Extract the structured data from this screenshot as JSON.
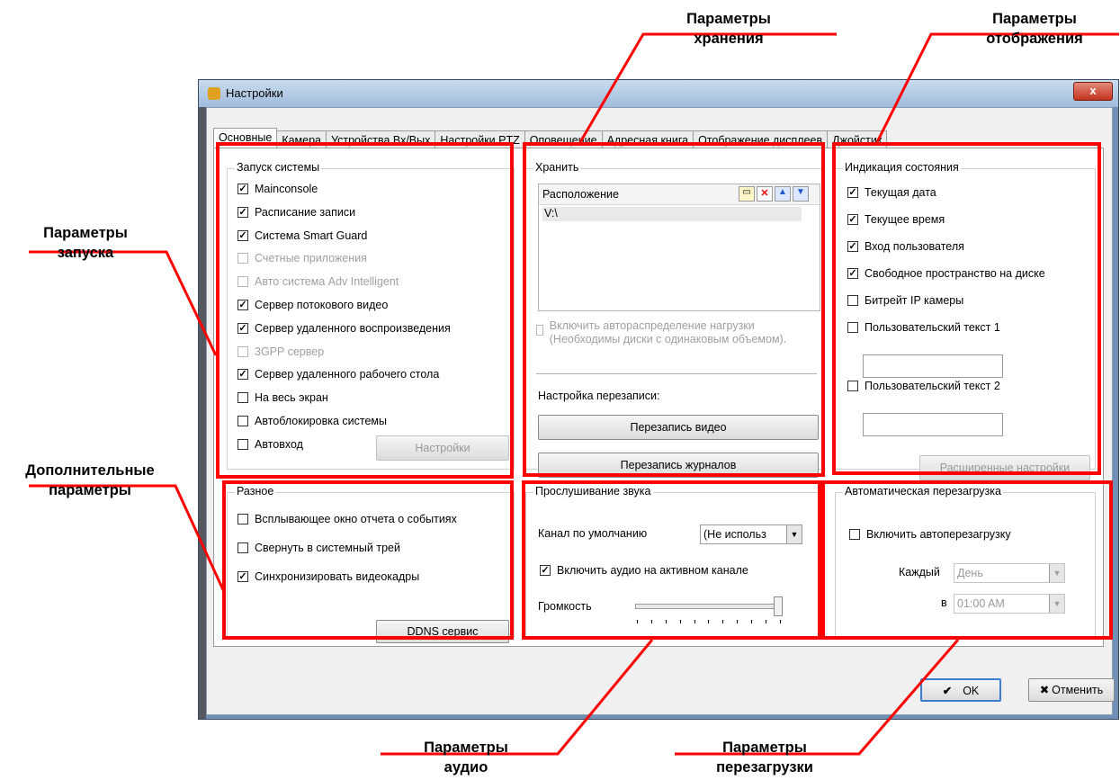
{
  "window": {
    "title": "Настройки",
    "close_glyph": "x"
  },
  "tabs": [
    "Основные",
    "Камера",
    "Устройства Вх/Вых",
    "Настройки PTZ",
    "Оповещение",
    "Адресная книга",
    "Отображение дисплеев",
    "Джойстик"
  ],
  "startup": {
    "title": "Запуск системы",
    "items": [
      {
        "label": "Mainconsole",
        "checked": true,
        "enabled": true
      },
      {
        "label": "Расписание записи",
        "checked": true,
        "enabled": true
      },
      {
        "label": "Система Smart Guard",
        "checked": true,
        "enabled": true
      },
      {
        "label": "Счетные приложения",
        "checked": false,
        "enabled": false
      },
      {
        "label": "Авто система Adv Intelligent",
        "checked": false,
        "enabled": false
      },
      {
        "label": "Сервер потокового видео",
        "checked": true,
        "enabled": true
      },
      {
        "label": "Сервер удаленного воспроизведения",
        "checked": true,
        "enabled": true
      },
      {
        "label": "3GPP сервер",
        "checked": false,
        "enabled": false
      },
      {
        "label": "Сервер удаленного рабочего стола",
        "checked": true,
        "enabled": true
      },
      {
        "label": "На весь экран",
        "checked": false,
        "enabled": true
      },
      {
        "label": "Автоблокировка системы",
        "checked": false,
        "enabled": true
      },
      {
        "label": "Автовход",
        "checked": false,
        "enabled": true
      }
    ],
    "settings_button": "Настройки"
  },
  "storage": {
    "title": "Хранить",
    "column": "Расположение",
    "paths": [
      "V:\\"
    ],
    "balance_label": "Включить автораспределение нагрузки (Необходимы диски с одинаковым объемом).",
    "overwrite_label": "Настройка перезаписи:",
    "video_button": "Перезапись видео",
    "logs_button": "Перезапись журналов"
  },
  "display": {
    "title": "Индикация состояния",
    "items": [
      {
        "label": "Текущая  дата",
        "checked": true
      },
      {
        "label": "Текущее время",
        "checked": true
      },
      {
        "label": "Вход пользователя",
        "checked": true
      },
      {
        "label": "Свободное пространство на диске",
        "checked": true
      },
      {
        "label": "Битрейт IP камеры",
        "checked": false
      },
      {
        "label": "Пользовательский текст 1",
        "checked": false
      },
      {
        "label": "Пользовательский текст 2",
        "checked": false
      }
    ],
    "advanced_button": "Расширенные настройки"
  },
  "misc": {
    "title": "Разное",
    "items": [
      {
        "label": "Всплывающее окно отчета о событиях",
        "checked": false
      },
      {
        "label": "Свернуть в системный трей",
        "checked": false
      },
      {
        "label": "Синхронизировать видеокадры",
        "checked": true
      }
    ],
    "ddns_button": "DDNS сервис"
  },
  "audio": {
    "title": "Прослушивание звука",
    "channel_label": "Канал по умолчанию",
    "channel_value": "(Не использ",
    "enable_label": "Включить аудио на активном канале",
    "enable_checked": true,
    "volume_label": "Громкость",
    "volume_level": 1.0
  },
  "reboot": {
    "title": "Автоматическая перезагрузка",
    "enable_label": "Включить автоперезагрузку",
    "enable_checked": false,
    "every_label": "Каждый",
    "every_value": "День",
    "at_label": "в",
    "at_value": "01:00 AM"
  },
  "footer": {
    "ok": "OK",
    "cancel": "Отменить",
    "check_glyph": "✔",
    "x_glyph": "✖"
  },
  "annotations": {
    "storage": "Параметры\nхранения",
    "display": "Параметры\nотображения",
    "startup": "Параметры\nзапуска",
    "extra": "Дополнительные\nпараметры",
    "audio": "Параметры\nаудио",
    "reboot": "Параметры\nперезагрузки"
  },
  "colors": {
    "highlight": "#ff0000",
    "title_close": "#c3321d"
  }
}
